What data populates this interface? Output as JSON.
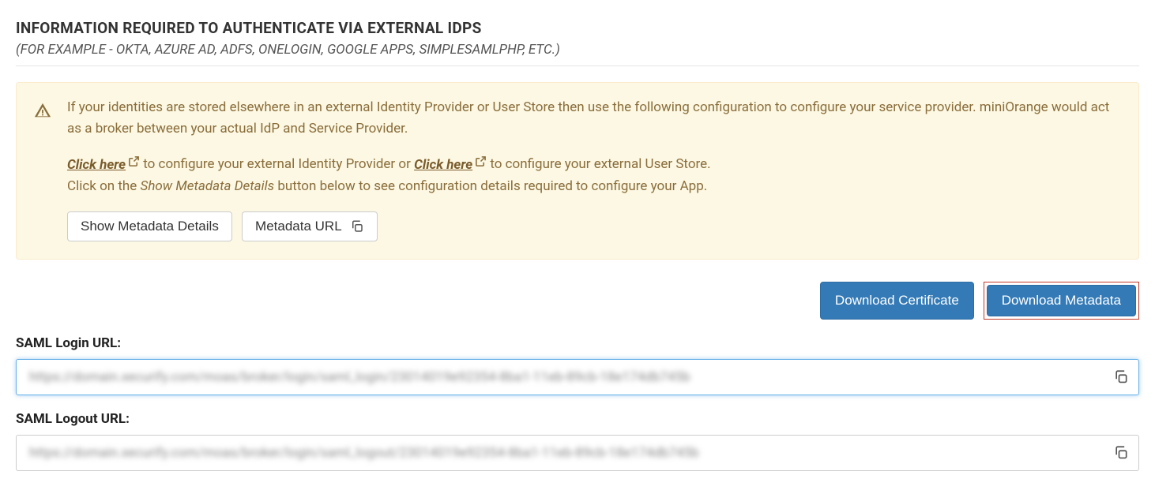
{
  "header": {
    "title": "INFORMATION REQUIRED TO AUTHENTICATE VIA EXTERNAL IDPS",
    "subtitle": "(FOR EXAMPLE - OKTA, AZURE AD, ADFS, ONELOGIN, GOOGLE APPS, SIMPLESAMLPHP, ETC.)"
  },
  "info": {
    "p1": "If your identities are stored elsewhere in an external Identity Provider or User Store then use the following configuration to configure your service provider. miniOrange would act as a broker between your actual IdP and Service Provider.",
    "click_here": "Click here",
    "p2a": " to configure your external Identity Provider or ",
    "p2b": " to configure your external User Store.",
    "p3a": "Click on the ",
    "p3_em": "Show Metadata Details",
    "p3b": " button below to see configuration details required to configure your App.",
    "btn_show": "Show Metadata Details",
    "btn_meta": "Metadata URL"
  },
  "downloads": {
    "cert": "Download Certificate",
    "meta": "Download Metadata"
  },
  "fields": {
    "login_label": "SAML Login URL:",
    "login_value": "https://domain.xecurify.com/moas/broker/login/saml_login/23014019e92354-8ba1-11eb-89cb-18e174db745b",
    "logout_label": "SAML Logout URL:",
    "logout_value": "https://domain.xecurify.com/moas/broker/login/saml_logout/23014019e92354-8ba1-11eb-89cb-18e174db745b"
  }
}
